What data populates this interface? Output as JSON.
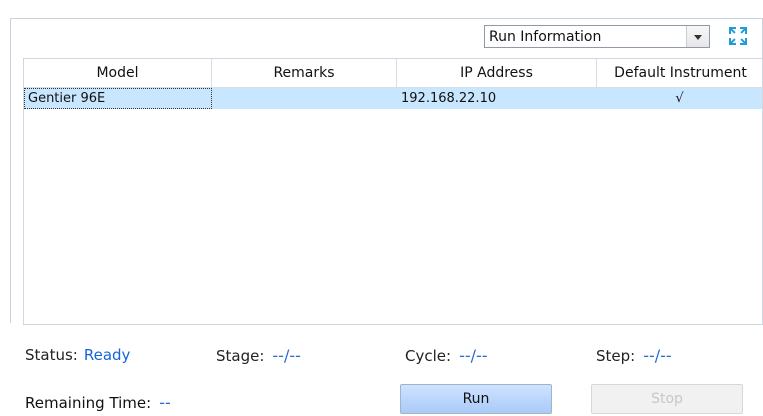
{
  "toolbar": {
    "view_select": "Run Information"
  },
  "table": {
    "columns": [
      "Model",
      "Remarks",
      "IP Address",
      "Default Instrument"
    ],
    "rows": [
      {
        "model": "Gentier 96E",
        "remarks": "",
        "ip": "192.168.22.10",
        "default": "√"
      }
    ]
  },
  "status": {
    "status_label": "Status:",
    "status_value": "Ready",
    "stage_label": "Stage:",
    "stage_value": "--/--",
    "cycle_label": "Cycle:",
    "cycle_value": "--/--",
    "step_label": "Step:",
    "step_value": "--/--",
    "remaining_label": "Remaining Time:",
    "remaining_value": "--"
  },
  "buttons": {
    "run": "Run",
    "stop": "Stop"
  },
  "colors": {
    "selection": "#c9e6ff",
    "status_value": "#1565d8",
    "run_button": "#b9d5fb"
  }
}
